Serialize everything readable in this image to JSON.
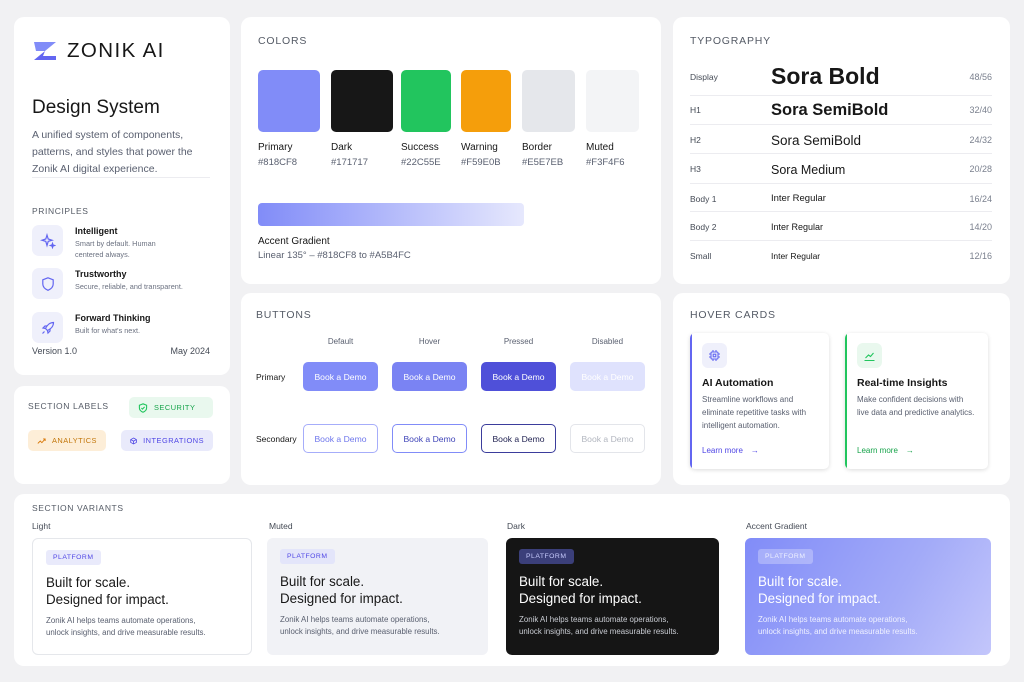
{
  "brand": {
    "logo_text": "ZONIK AI",
    "title": "Design System",
    "description": "A unified system of components, patterns, and styles that power the Zonik AI digital experience.",
    "principles_title": "PRINCIPLES",
    "principles": [
      {
        "name": "Intelligent",
        "desc": "Smart by default. Human centered always.",
        "icon": "sparkle-icon"
      },
      {
        "name": "Trustworthy",
        "desc": "Secure, reliable, and transparent.",
        "icon": "shield-icon"
      },
      {
        "name": "Forward Thinking",
        "desc": "Built for what's next.",
        "icon": "rocket-icon"
      }
    ],
    "version": "Version 1.0",
    "date": "May 2024"
  },
  "section_labels": {
    "title": "SECTION LABELS",
    "chips": [
      {
        "label": "SECURITY",
        "icon": "shield-check-icon",
        "color": "#22C55E",
        "bg": "#e9f8ee"
      },
      {
        "label": "ANALYTICS",
        "icon": "trend-icon",
        "color": "#d97706",
        "bg": "#fdeed8"
      },
      {
        "label": "INTEGRATIONS",
        "icon": "cube-icon",
        "color": "#4f46e5",
        "bg": "#e9eafb"
      }
    ]
  },
  "colors": {
    "title": "COLORS",
    "swatches": [
      {
        "name": "Primary",
        "hex": "#818CF8"
      },
      {
        "name": "Dark",
        "hex": "#171717"
      },
      {
        "name": "Success",
        "hex": "#22C55E"
      },
      {
        "name": "Warning",
        "hex": "#F59E0B"
      },
      {
        "name": "Border",
        "hex": "#E5E7EB"
      },
      {
        "name": "Muted",
        "hex": "#F3F4F6"
      }
    ],
    "gradient": {
      "name": "Accent Gradient",
      "desc": "Linear 135° – #818CF8 to #A5B4FC"
    }
  },
  "typography": {
    "title": "TYPOGRAPHY",
    "rows": [
      {
        "label": "Display",
        "sample": "Sora Bold",
        "size": "48/56"
      },
      {
        "label": "H1",
        "sample": "Sora SemiBold",
        "size": "32/40"
      },
      {
        "label": "H2",
        "sample": "Sora SemiBold",
        "size": "24/32"
      },
      {
        "label": "H3",
        "sample": "Sora Medium",
        "size": "20/28"
      },
      {
        "label": "Body 1",
        "sample": "Inter Regular",
        "size": "16/24"
      },
      {
        "label": "Body 2",
        "sample": "Inter Regular",
        "size": "14/20"
      },
      {
        "label": "Small",
        "sample": "Inter Regular",
        "size": "12/16"
      }
    ]
  },
  "buttons": {
    "title": "BUTTONS",
    "states": [
      "Default",
      "Hover",
      "Pressed",
      "Disabled"
    ],
    "rows": [
      "Primary",
      "Secondary"
    ],
    "label": "Book a Demo"
  },
  "hover_cards": {
    "title": "HOVER CARDS",
    "cards": [
      {
        "title": "AI Automation",
        "desc": "Streamline workflows and eliminate repetitive tasks with intelligent automation.",
        "link": "Learn more",
        "icon": "chip-icon",
        "accent": "#6366f1"
      },
      {
        "title": "Real-time Insights",
        "desc": "Make confident decisions with live data and predictive analytics.",
        "link": "Learn more",
        "icon": "chart-icon",
        "accent": "#22C55E"
      }
    ]
  },
  "variants": {
    "title": "SECTION VARIANTS",
    "items": [
      {
        "label": "Light",
        "chip": "PLATFORM",
        "line1": "Built for scale.",
        "line2": "Designed for impact.",
        "desc1": "Zonik AI helps teams automate operations,",
        "desc2": "unlock insights, and drive measurable results."
      },
      {
        "label": "Muted",
        "chip": "PLATFORM",
        "line1": "Built for scale.",
        "line2": "Designed for impact.",
        "desc1": "Zonik AI helps teams automate operations,",
        "desc2": "unlock insights, and drive measurable results."
      },
      {
        "label": "Dark",
        "chip": "PLATFORM",
        "line1": "Built for scale.",
        "line2": "Designed for impact.",
        "desc1": "Zonik AI helps teams automate operations,",
        "desc2": "unlock insights, and drive measurable results."
      },
      {
        "label": "Accent Gradient",
        "chip": "PLATFORM",
        "line1": "Built for scale.",
        "line2": "Designed for impact.",
        "desc1": "Zonik AI helps teams automate operations,",
        "desc2": "unlock insights, and drive measurable results."
      }
    ]
  }
}
